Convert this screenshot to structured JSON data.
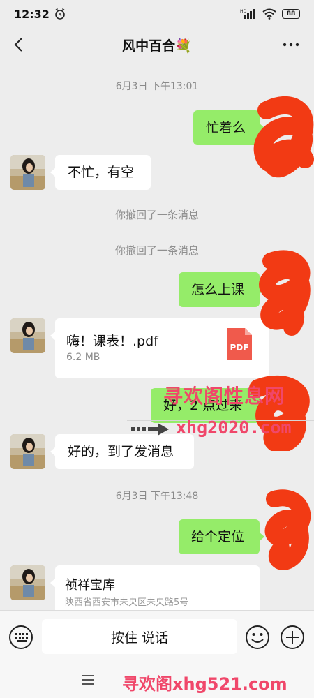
{
  "status_bar": {
    "time": "12:32",
    "battery": "88",
    "network_label": "HD"
  },
  "header": {
    "title": "风中百合💐"
  },
  "messages": {
    "ts1": "6月3日 下午13:01",
    "m1": "忙着么",
    "m2": "不忙，有空",
    "recall1": "你撤回了一条消息",
    "recall2": "你撤回了一条消息",
    "m3": "怎么上课",
    "file_name": "嗨！课表！.pdf",
    "file_size": "6.2 MB",
    "file_icon_label": "PDF",
    "m4": "好，2 点过来",
    "m5": "好的，到了发消息",
    "ts2": "6月3日 下午13:48",
    "m6": "给个定位",
    "location_title": "祯祥宝库",
    "location_address": "陕西省西安市未央区未央路5号"
  },
  "input": {
    "voice_label": "按住 说话"
  },
  "watermarks": {
    "title": "寻欢阁性息网",
    "url": "xhg2020.com",
    "bottom": "寻欢阁xhg521.com"
  },
  "colors": {
    "sent_bubble": "#95ec69",
    "background": "#ededed",
    "watermark": "#f0476a",
    "scribble": "#f23a14"
  },
  "icons": [
    "alarm-icon",
    "signal-icon",
    "wifi-icon",
    "battery-icon",
    "back-arrow-icon",
    "more-icon",
    "pdf-icon",
    "keyboard-icon",
    "emoji-icon",
    "plus-icon",
    "menu-icon"
  ]
}
